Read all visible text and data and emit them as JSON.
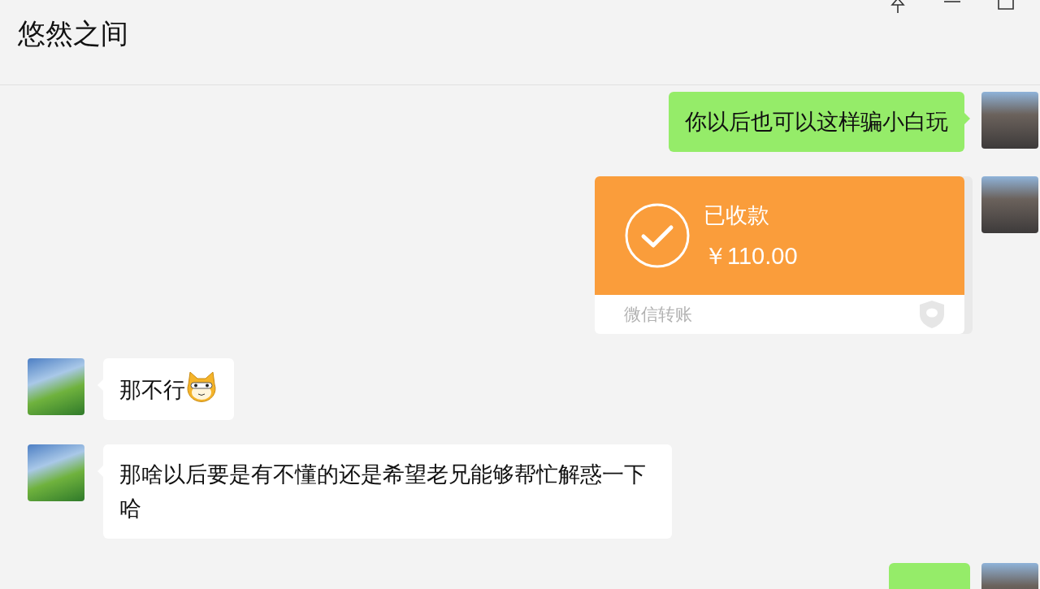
{
  "window": {
    "title": "悠然之间"
  },
  "messages": [
    {
      "outgoing": true,
      "kind": "text",
      "text": "你以后也可以这样骗小白玩"
    },
    {
      "outgoing": true,
      "kind": "transfer",
      "status": "已收款",
      "amount": "￥110.00",
      "footer": "微信转账"
    },
    {
      "outgoing": false,
      "kind": "text",
      "text": "那不行",
      "emoji_after": true
    },
    {
      "outgoing": false,
      "kind": "text",
      "text": "那啥以后要是有不懂的还是希望老兄能够帮忙解惑一下哈"
    },
    {
      "outgoing": true,
      "kind": "partial"
    }
  ]
}
